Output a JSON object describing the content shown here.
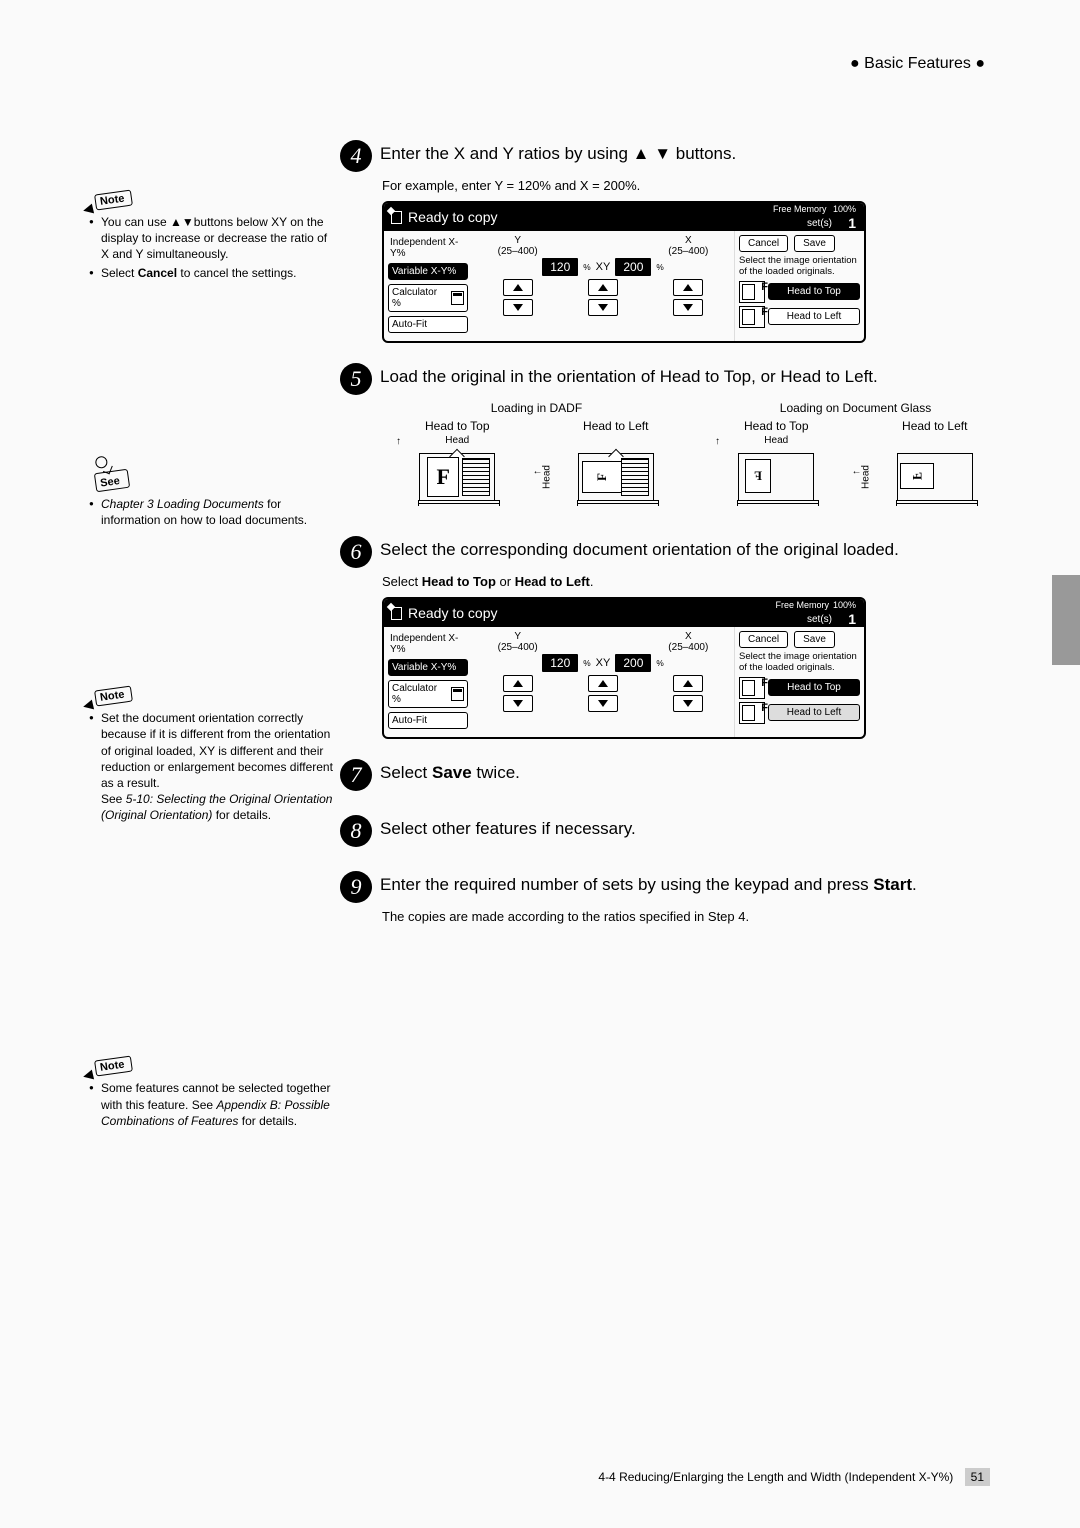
{
  "header": {
    "section": "Basic Features"
  },
  "left": {
    "notes1": {
      "flag": "Note",
      "items": [
        {
          "pre": "You can use ",
          "post": "buttons below XY on the display to increase or decrease the ratio of X and Y simultaneously."
        },
        {
          "seg1": "Select ",
          "bold": "Cancel",
          "seg2": " to cancel the settings."
        }
      ]
    },
    "see": {
      "flag": "See",
      "link": "Chapter 3 Loading Documents",
      "after": " for information on how to load documents."
    },
    "notes2": {
      "flag": "Note",
      "text1": "Set the document orientation correctly because if it is different from the orientation of original loaded, XY is different and their reduction or enlargement becomes different as a result.",
      "see_pre": "See ",
      "see_it": "5-10: Selecting the Original Orientation (Original Orientation)",
      "see_post": " for details."
    },
    "notes3": {
      "flag": "Note",
      "text_pre": "Some features cannot be selected together with this feature. See ",
      "text_it": "Appendix B: Possible Combinations of Features",
      "text_post": " for details."
    }
  },
  "steps": {
    "s4": {
      "num": "4",
      "text": "Enter the X and Y ratios by using ▲ ▼ buttons.",
      "sub": "For example, enter Y = 120% and X = 200%."
    },
    "s5": {
      "num": "5",
      "text": "Load the original in the orientation of Head to Top, or Head to Left."
    },
    "s6": {
      "num": "6",
      "text": "Select the corresponding document orientation of the original loaded.",
      "sub_pre": "Select ",
      "sub_b1": "Head to Top",
      "sub_mid": " or ",
      "sub_b2": "Head to Left",
      "sub_post": "."
    },
    "s7": {
      "num": "7",
      "text_pre": "Select ",
      "text_b": "Save",
      "text_post": " twice."
    },
    "s8": {
      "num": "8",
      "text": "Select other features if necessary."
    },
    "s9": {
      "num": "9",
      "text_pre": "Enter the required number of sets by using the keypad and press ",
      "text_b": "Start",
      "text_post": ".",
      "sub": "The copies are made according to the ratios specified in Step 4."
    }
  },
  "panel": {
    "ready": "Ready to copy",
    "free_mem": "Free Memory",
    "mem_pct": "100%",
    "sets_label": "set(s)",
    "sets_num": "1",
    "independent": "Independent X-Y%",
    "cancel": "Cancel",
    "save": "Save",
    "Y": "Y",
    "X": "X",
    "range": "(25–400)",
    "val_y": "120",
    "val_x": "200",
    "pct": "%",
    "xy": "XY",
    "variable": "Variable X-Y%",
    "calculator": "Calculator %",
    "autofit": "Auto-Fit",
    "orient_msg": "Select the image orientation of the loaded originals.",
    "htt": "Head to Top",
    "htl": "Head to Left"
  },
  "loading": {
    "dadf": "Loading in DADF",
    "glass": "Loading on Document Glass",
    "htt": "Head to Top",
    "htl": "Head to Left",
    "head": "Head"
  },
  "footer": {
    "text": "4-4  Reducing/Enlarging the Length and Width (Independent X-Y%)",
    "page": "51"
  }
}
